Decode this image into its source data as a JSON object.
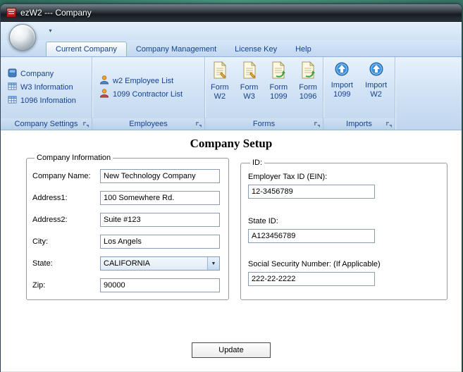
{
  "window": {
    "title": "ezW2 --- Company"
  },
  "ribbon": {
    "tabs": [
      {
        "label": "Current Company"
      },
      {
        "label": "Company Management"
      },
      {
        "label": "License Key"
      },
      {
        "label": "Help"
      }
    ],
    "groups": [
      {
        "label": "Company Settings",
        "items": [
          {
            "label": "Company"
          },
          {
            "label": "W3 Information"
          },
          {
            "label": "1096 Infomation"
          }
        ]
      },
      {
        "label": "Employees",
        "items": [
          {
            "label": "w2 Employee List"
          },
          {
            "label": "1099 Contractor List"
          }
        ]
      },
      {
        "label": "Forms",
        "items": [
          {
            "line1": "Form",
            "line2": "W2"
          },
          {
            "line1": "Form",
            "line2": "W3"
          },
          {
            "line1": "Form",
            "line2": "1099"
          },
          {
            "line1": "Form",
            "line2": "1096"
          }
        ]
      },
      {
        "label": "Imports",
        "items": [
          {
            "line1": "Import",
            "line2": "1099"
          },
          {
            "line1": "Import",
            "line2": "W2"
          }
        ]
      }
    ]
  },
  "main": {
    "title": "Company Setup",
    "company_info": {
      "legend": "Company Information",
      "fields": [
        {
          "label": "Company Name:",
          "value": "New Technology Company"
        },
        {
          "label": "Address1:",
          "value": "100 Somewhere Rd."
        },
        {
          "label": "Address2:",
          "value": "Suite #123"
        },
        {
          "label": "City:",
          "value": "Los Angels"
        },
        {
          "label": "State:",
          "value": "CALIFORNIA"
        },
        {
          "label": "Zip:",
          "value": "90000"
        }
      ]
    },
    "ids": {
      "legend": "ID:",
      "fields": [
        {
          "label": "Employer Tax ID (EIN):",
          "value": "12-3456789"
        },
        {
          "label": "State ID:",
          "value": "A123456789"
        },
        {
          "label": "Social Security Number: (If Applicable)",
          "value": "222-22-2222"
        }
      ]
    },
    "update_label": "Update"
  }
}
